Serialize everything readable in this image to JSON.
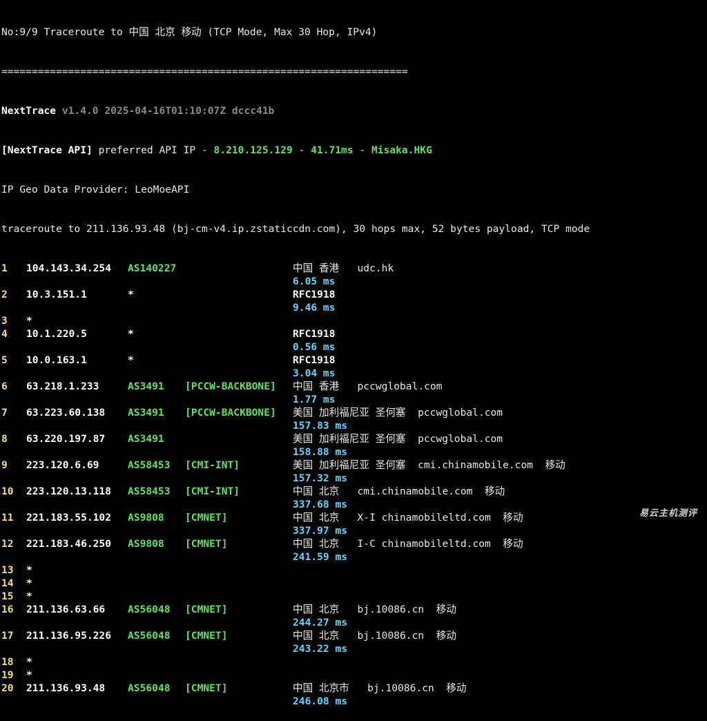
{
  "header": {
    "title_line": "No:9/9 Traceroute to 中国 北京 移动 (TCP Mode, Max 30 Hop, IPv4)",
    "separator": "===================================================================",
    "app_name": "NextTrace",
    "app_version": "v1.4.0 2025-04-16T01:10:07Z dccc41b",
    "api_prefix": "[NextTrace API]",
    "api_text": " preferred API IP - ",
    "api_ip": "8.210.125.129",
    "api_dash1": " - ",
    "api_latency": "41.71ms",
    "api_dash2": " - ",
    "api_node": "Misaka.HKG",
    "geo_provider": "IP Geo Data Provider: LeoMoeAPI",
    "traceroute_line": "traceroute to 211.136.93.48 (bj-cm-v4.ip.zstaticcdn.com), 30 hops max, 52 bytes payload, TCP mode"
  },
  "hops": [
    {
      "num": "1",
      "ip": "104.143.34.254",
      "as": "AS140227",
      "tag": "",
      "geo": "中国 香港   udc.hk",
      "rtt": "6.05 ms"
    },
    {
      "num": "2",
      "ip": "10.3.151.1",
      "as": "*",
      "tag": "",
      "geo": "RFC1918",
      "rtt": "9.46 ms"
    },
    {
      "num": "3",
      "ip": "*",
      "as": "",
      "tag": "",
      "geo": "",
      "rtt": ""
    },
    {
      "num": "4",
      "ip": "10.1.220.5",
      "as": "*",
      "tag": "",
      "geo": "RFC1918",
      "rtt": "0.56 ms"
    },
    {
      "num": "5",
      "ip": "10.0.163.1",
      "as": "*",
      "tag": "",
      "geo": "RFC1918",
      "rtt": "3.04 ms"
    },
    {
      "num": "6",
      "ip": "63.218.1.233",
      "as": "AS3491",
      "tag": "[PCCW-BACKBONE]",
      "geo": "中国 香港   pccwglobal.com",
      "rtt": "1.77 ms"
    },
    {
      "num": "7",
      "ip": "63.223.60.138",
      "as": "AS3491",
      "tag": "[PCCW-BACKBONE]",
      "geo": "美国 加利福尼亚 圣何塞  pccwglobal.com",
      "rtt": "157.83 ms"
    },
    {
      "num": "8",
      "ip": "63.220.197.87",
      "as": "AS3491",
      "tag": "",
      "geo": "美国 加利福尼亚 圣何塞  pccwglobal.com",
      "rtt": "158.88 ms"
    },
    {
      "num": "9",
      "ip": "223.120.6.69",
      "as": "AS58453",
      "tag": "[CMI-INT]",
      "geo": "美国 加利福尼亚 圣何塞  cmi.chinamobile.com  移动",
      "rtt": "157.32 ms"
    },
    {
      "num": "10",
      "ip": "223.120.13.118",
      "as": "AS58453",
      "tag": "[CMI-INT]",
      "geo": "中国 北京   cmi.chinamobile.com  移动",
      "rtt": "337.68 ms"
    },
    {
      "num": "11",
      "ip": "221.183.55.102",
      "as": "AS9808",
      "tag": "[CMNET]",
      "geo": "中国 北京   X-I chinamobileltd.com  移动",
      "rtt": "337.97 ms"
    },
    {
      "num": "12",
      "ip": "221.183.46.250",
      "as": "AS9808",
      "tag": "[CMNET]",
      "geo": "中国 北京   I-C chinamobileltd.com  移动",
      "rtt": "241.59 ms"
    },
    {
      "num": "13",
      "ip": "*",
      "as": "",
      "tag": "",
      "geo": "",
      "rtt": ""
    },
    {
      "num": "14",
      "ip": "*",
      "as": "",
      "tag": "",
      "geo": "",
      "rtt": ""
    },
    {
      "num": "15",
      "ip": "*",
      "as": "",
      "tag": "",
      "geo": "",
      "rtt": ""
    },
    {
      "num": "16",
      "ip": "211.136.63.66",
      "as": "AS56048",
      "tag": "[CMNET]",
      "geo": "中国 北京   bj.10086.cn  移动",
      "rtt": "244.27 ms"
    },
    {
      "num": "17",
      "ip": "211.136.95.226",
      "as": "AS56048",
      "tag": "[CMNET]",
      "geo": "中国 北京   bj.10086.cn  移动",
      "rtt": "243.22 ms"
    },
    {
      "num": "18",
      "ip": "*",
      "as": "",
      "tag": "",
      "geo": "",
      "rtt": ""
    },
    {
      "num": "19",
      "ip": "*",
      "as": "",
      "tag": "",
      "geo": "",
      "rtt": ""
    },
    {
      "num": "20",
      "ip": "211.136.93.48",
      "as": "AS56048",
      "tag": "[CMNET]",
      "geo": "中国 北京市   bj.10086.cn  移动",
      "rtt": "246.08 ms"
    }
  ],
  "watermark": "易云主机测评",
  "colors": {
    "background": "#000000",
    "text": "#e8e8e8",
    "as_green": "#5fe35f",
    "rtt_cyan": "#5fd7ff",
    "hop_yellow": "#f2e07a",
    "version_gray": "#8a8a8a"
  }
}
